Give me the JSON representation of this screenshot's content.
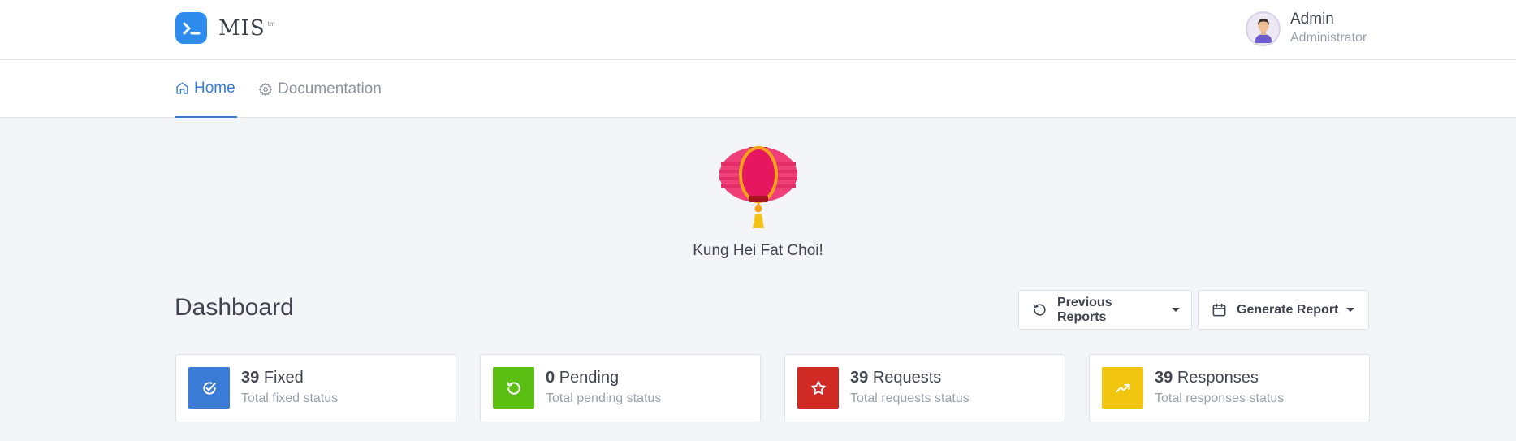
{
  "brand": {
    "name": "MIS",
    "sup": "tm",
    "logo_icon": "terminal-icon",
    "accent": "#2f8cef"
  },
  "user": {
    "name": "Admin",
    "role": "Administrator",
    "avatar_icon": "user-avatar"
  },
  "nav": {
    "tabs": [
      {
        "label": "Home",
        "icon": "home-icon",
        "active": true
      },
      {
        "label": "Documentation",
        "icon": "gear-icon",
        "active": false
      }
    ]
  },
  "banner": {
    "greeting": "Kung Hei Fat Choi!",
    "image": "lantern"
  },
  "dashboard": {
    "title": "Dashboard",
    "previous_reports_label": "Previous Reports",
    "generate_report_label": "Generate Report"
  },
  "stats": [
    {
      "value": "39",
      "label": "Fixed",
      "subtitle": "Total fixed status",
      "color": "#3a7bd5",
      "icon": "check-circle-icon"
    },
    {
      "value": "0",
      "label": "Pending",
      "subtitle": "Total pending status",
      "color": "#5bbf13",
      "icon": "refresh-icon"
    },
    {
      "value": "39",
      "label": "Requests",
      "subtitle": "Total requests status",
      "color": "#d02a25",
      "icon": "star-icon"
    },
    {
      "value": "39",
      "label": "Responses",
      "subtitle": "Total responses status",
      "color": "#f1c40f",
      "icon": "trending-up-icon"
    }
  ]
}
